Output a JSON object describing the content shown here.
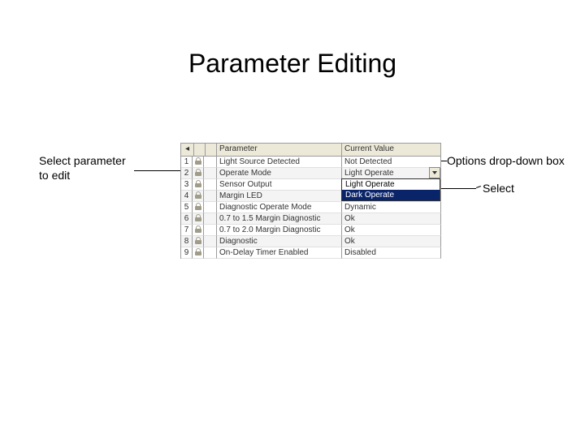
{
  "title": "Parameter Editing",
  "annotations": {
    "left": "Select parameter\nto edit",
    "right1": "Options drop-down box",
    "right2": "Select"
  },
  "table": {
    "headers": {
      "index": " ",
      "num": " ",
      "lock": " ",
      "param": "Parameter",
      "value": "Current Value"
    },
    "rows": [
      {
        "n": "1",
        "param": "Light Source Detected",
        "value": "Not Detected"
      },
      {
        "n": "2",
        "param": "Operate Mode",
        "value": "Light Operate"
      },
      {
        "n": "3",
        "param": "Sensor Output",
        "value": " "
      },
      {
        "n": "4",
        "param": "Margin LED",
        "value": " "
      },
      {
        "n": "5",
        "param": "Diagnostic Operate Mode",
        "value": "Dynamic"
      },
      {
        "n": "6",
        "param": "0.7 to 1.5 Margin Diagnostic",
        "value": "Ok"
      },
      {
        "n": "7",
        "param": "0.7 to 2.0 Margin Diagnostic",
        "value": "Ok"
      },
      {
        "n": "8",
        "param": "Diagnostic",
        "value": "Ok"
      },
      {
        "n": "9",
        "param": "On-Delay Timer Enabled",
        "value": "Disabled"
      }
    ]
  },
  "dropdown": {
    "options": [
      "Light Operate",
      "Dark Operate"
    ],
    "selected_index": 1
  }
}
